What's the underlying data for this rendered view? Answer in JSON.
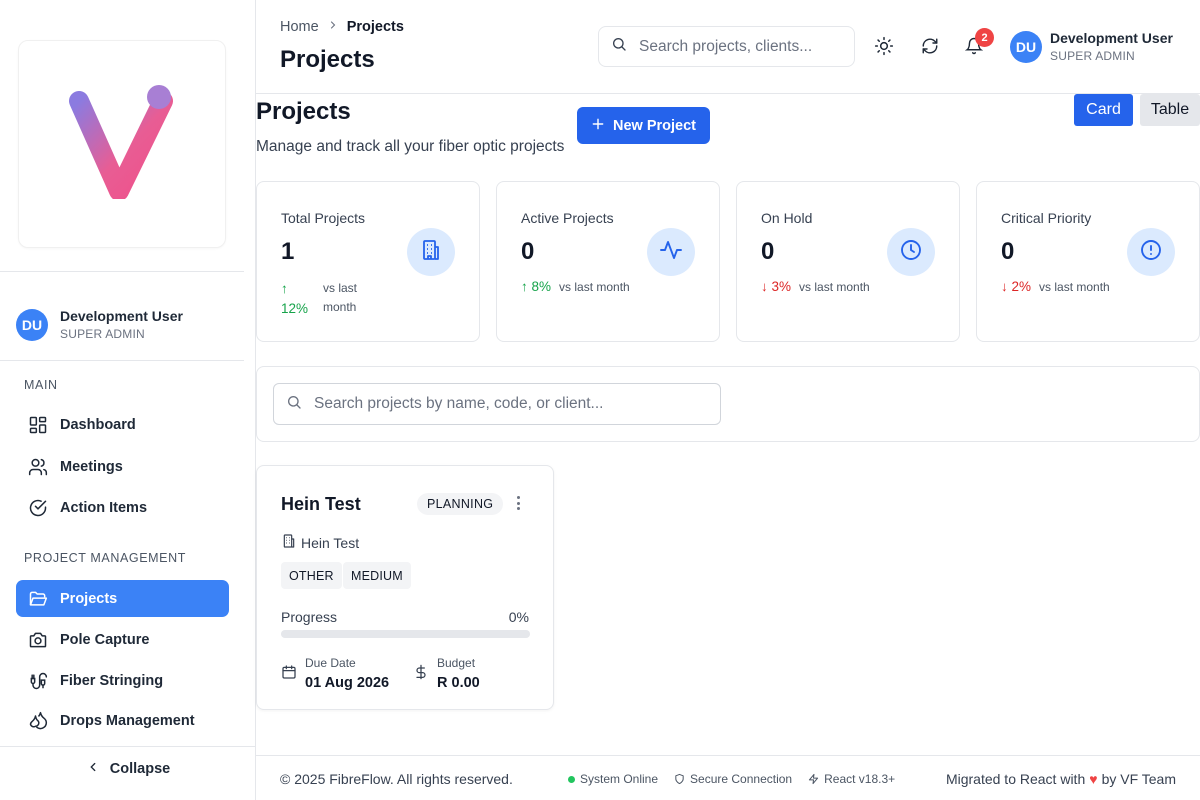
{
  "sidebar": {
    "user": {
      "initials": "DU",
      "name": "Development User",
      "role": "SUPER ADMIN"
    },
    "sections": [
      {
        "title": "MAIN",
        "items": [
          {
            "label": "Dashboard",
            "icon": "dashboard-icon"
          },
          {
            "label": "Meetings",
            "icon": "users-icon"
          },
          {
            "label": "Action Items",
            "icon": "check-circle-icon"
          }
        ]
      },
      {
        "title": "PROJECT MANAGEMENT",
        "items": [
          {
            "label": "Projects",
            "icon": "folder-open-icon",
            "active": true
          },
          {
            "label": "Pole Capture",
            "icon": "camera-icon"
          },
          {
            "label": "Fiber Stringing",
            "icon": "cable-icon"
          },
          {
            "label": "Drops Management",
            "icon": "droplets-icon"
          }
        ]
      }
    ],
    "collapse_label": "Collapse"
  },
  "header": {
    "breadcrumb": [
      "Home",
      "Projects"
    ],
    "title": "Projects",
    "search_placeholder": "Search projects, clients...",
    "notification_count": "2",
    "user": {
      "initials": "DU",
      "name": "Development User",
      "role": "SUPER ADMIN"
    }
  },
  "main": {
    "title": "Projects",
    "subtitle": "Manage and track all your fiber optic projects",
    "new_button": "New Project",
    "view_toggle": {
      "card": "Card",
      "table": "Table",
      "selected": "Card"
    },
    "stats": [
      {
        "label": "Total Projects",
        "value": "1",
        "trend_arrow": "↑",
        "trend_pct": "12%",
        "direction": "up",
        "vs": "vs last month",
        "icon": "building-icon"
      },
      {
        "label": "Active Projects",
        "value": "0",
        "trend_arrow": "↑",
        "trend_pct": "8%",
        "direction": "up",
        "vs": "vs last month",
        "icon": "activity-icon"
      },
      {
        "label": "On Hold",
        "value": "0",
        "trend_arrow": "↓",
        "trend_pct": "3%",
        "direction": "down",
        "vs": "vs last month",
        "icon": "clock-icon"
      },
      {
        "label": "Critical Priority",
        "value": "0",
        "trend_arrow": "↓",
        "trend_pct": "2%",
        "direction": "down",
        "vs": "vs last month",
        "icon": "alert-circle-icon"
      }
    ],
    "search_placeholder": "Search projects by name, code, or client...",
    "projects": [
      {
        "name": "Hein Test",
        "status": "PLANNING",
        "client": "Hein Test",
        "tags": [
          "OTHER",
          "MEDIUM"
        ],
        "progress_label": "Progress",
        "progress_text": "0%",
        "progress": 0,
        "due_label": "Due Date",
        "due_value": "01 Aug 2026",
        "budget_label": "Budget",
        "budget_value": "R 0.00"
      }
    ]
  },
  "footer": {
    "copyright": "© 2025 FibreFlow. All rights reserved.",
    "system_status": "System Online",
    "connection": "Secure Connection",
    "react_version": "React v18.3+",
    "migrated_prefix": "Migrated to React with",
    "migrated_suffix": "by VF Team"
  },
  "colors": {
    "accent": "#2563eb",
    "sidebar_active": "#3b82f6",
    "up": "#16a34a",
    "down": "#dc2626",
    "badge": "#ef4444"
  }
}
